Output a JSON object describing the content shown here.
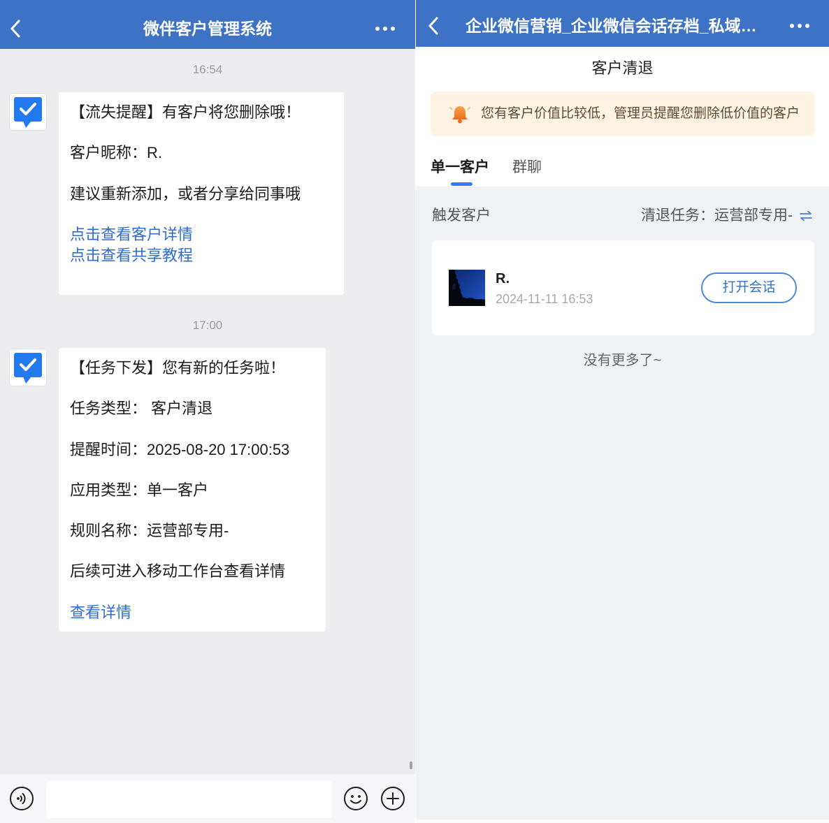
{
  "left": {
    "header": {
      "title": "微伴客户管理系统",
      "back_icon": "chevron-left-icon",
      "more_icon": "more-icon"
    },
    "messages": [
      {
        "time": "16:54",
        "sender_icon": "checkmark-chat-icon",
        "lines": [
          "【流失提醒】有客户将您删除哦！",
          "客户昵称：R.",
          "建议重新添加，或者分享给同事哦"
        ],
        "links": [
          "点击查看客户详情",
          "点击查看共享教程"
        ]
      },
      {
        "time": "17:00",
        "sender_icon": "checkmark-chat-icon",
        "lines": [
          "【任务下发】您有新的任务啦！",
          "任务类型： 客户清退",
          "提醒时间：2025-08-20 17:00:53",
          "应用类型：单一客户",
          "规则名称：运营部专用-",
          "后续可进入移动工作台查看详情"
        ],
        "links": [
          "查看详情"
        ]
      }
    ],
    "input_bar": {
      "voice_icon": "voice-icon",
      "emoji_icon": "emoji-icon",
      "plus_icon": "plus-icon"
    }
  },
  "right": {
    "header": {
      "title": "企业微信营销_企业微信会话存档_私域…",
      "back_icon": "chevron-left-icon",
      "more_icon": "more-icon"
    },
    "page_title": "客户清退",
    "notice": {
      "icon": "bell-icon",
      "text": "您有客户价值比较低，管理员提醒您删除低价值的客户"
    },
    "tabs": [
      {
        "label": "单一客户",
        "active": true
      },
      {
        "label": "群聊",
        "active": false
      }
    ],
    "section_label": "触发客户",
    "task_filter": {
      "label": "清退任务：运营部专用-",
      "icon": "swap-icon"
    },
    "customers": [
      {
        "name": "R.",
        "time": "2024-11-11 16:53",
        "action": "打开会话"
      }
    ],
    "end_text": "没有更多了~"
  },
  "colors": {
    "header_blue": "#3d72c4",
    "link_blue": "#2f6dcc",
    "accent_blue": "#2f7cf6",
    "notice_background": "#fdf3e2",
    "bell_orange": "#f08a24",
    "chat_background": "#ededf0"
  }
}
